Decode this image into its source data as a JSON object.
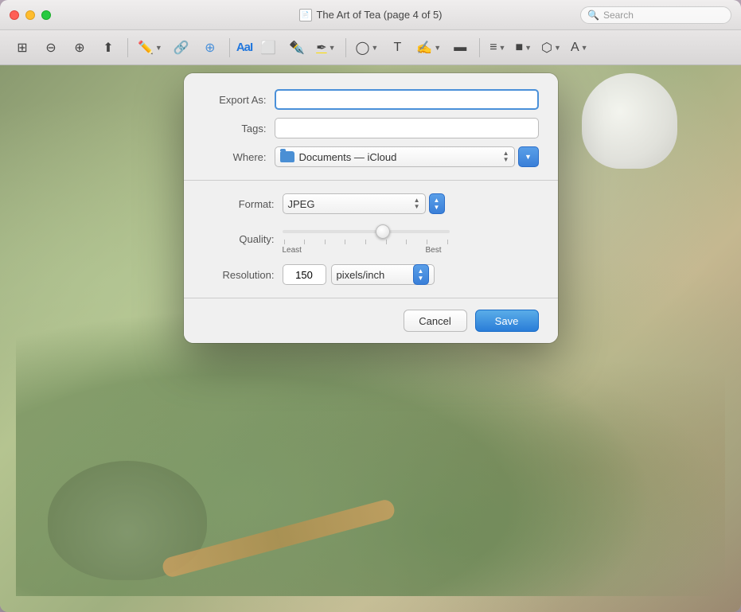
{
  "window": {
    "title": "The Art of Tea (page 4 of 5)"
  },
  "titlebar": {
    "title": "The Art of Tea (page 4 of 5)",
    "doc_icon": "📄"
  },
  "toolbar": {
    "search_placeholder": "Search"
  },
  "dialog": {
    "export_as_label": "Export As:",
    "export_as_placeholder": "",
    "tags_label": "Tags:",
    "tags_placeholder": "",
    "where_label": "Where:",
    "where_value": "Documents — iCloud",
    "format_label": "Format:",
    "format_value": "JPEG",
    "quality_label": "Quality:",
    "quality_least": "Least",
    "quality_best": "Best",
    "resolution_label": "Resolution:",
    "resolution_value": "150",
    "resolution_unit": "pixels/inch",
    "cancel_label": "Cancel",
    "save_label": "Save"
  }
}
